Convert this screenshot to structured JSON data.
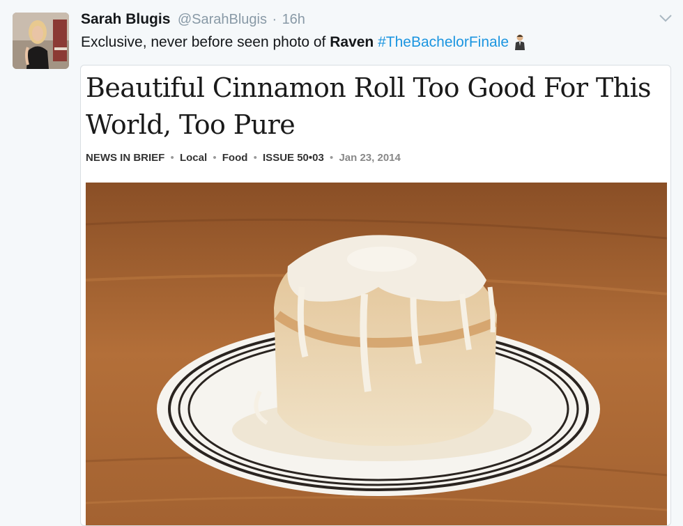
{
  "user": {
    "name": "Sarah Blugis",
    "handle": "@SarahBlugis",
    "separator": "·",
    "time": "16h"
  },
  "tweet": {
    "text_before": "Exclusive, never before seen photo of ",
    "text_bold": "Raven",
    "text_space": " ",
    "hashtag": "#TheBachelorFinale",
    "emoji_icon": "person-in-suit-emoji"
  },
  "card": {
    "headline": "Beautiful Cinnamon Roll Too Good For This World, Too Pure",
    "meta": {
      "section": "NEWS IN BRIEF",
      "tags": [
        "Local",
        "Food",
        "ISSUE 50•03"
      ],
      "separator": "•",
      "date": "Jan 23, 2014"
    },
    "image_icon": "cinnamon-roll-photo"
  },
  "colors": {
    "hashtag": "#1b95e0",
    "muted": "#8899a6",
    "text": "#14171a"
  }
}
